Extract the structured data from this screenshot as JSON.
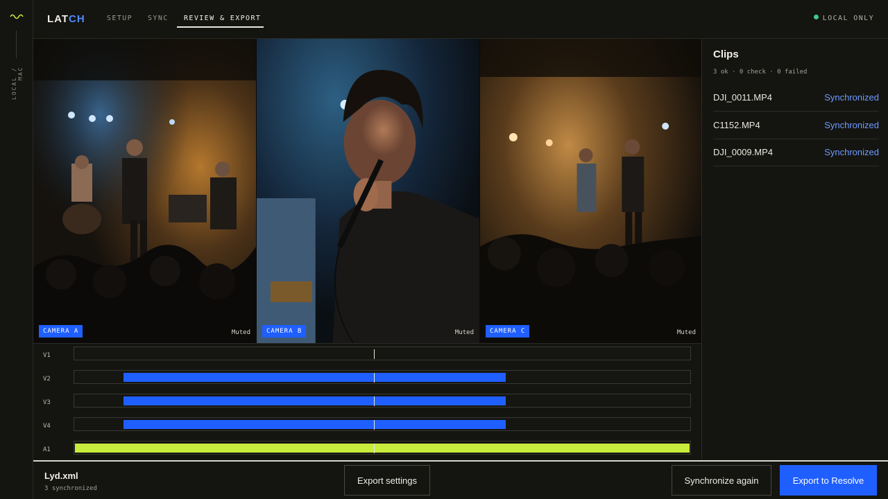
{
  "rail": {
    "logo_icon": "wave-icon",
    "context_label": "LOCAL / MAC"
  },
  "header": {
    "brand_prefix": "LAT",
    "brand_accent": "CH",
    "tabs": [
      {
        "label": "SETUP",
        "active": false
      },
      {
        "label": "SYNC",
        "active": false
      },
      {
        "label": "REVIEW & EXPORT",
        "active": true
      }
    ],
    "status_label": "LOCAL ONLY",
    "status_color": "#3ec98a"
  },
  "cameras": [
    {
      "label": "CAMERA A",
      "audio": "Muted"
    },
    {
      "label": "CAMERA B",
      "audio": "Muted"
    },
    {
      "label": "CAMERA C",
      "audio": "Muted"
    }
  ],
  "clips_panel": {
    "title": "Clips",
    "summary": "3 ok · 0 check · 0 failed",
    "clips": [
      {
        "name": "DJI_0011.MP4",
        "status": "Synchronized"
      },
      {
        "name": "C1152.MP4",
        "status": "Synchronized"
      },
      {
        "name": "DJI_0009.MP4",
        "status": "Synchronized"
      }
    ]
  },
  "timeline": {
    "tracks": [
      {
        "label": "V1",
        "kind": "video",
        "has_clip": false
      },
      {
        "label": "V2",
        "kind": "video",
        "has_clip": true
      },
      {
        "label": "V3",
        "kind": "video",
        "has_clip": true
      },
      {
        "label": "V4",
        "kind": "video",
        "has_clip": true
      },
      {
        "label": "A1",
        "kind": "audio",
        "has_clip": true
      }
    ],
    "video_clip_color": "#1f5fff",
    "audio_clip_color": "#c7ec3c"
  },
  "footer": {
    "file_name": "Lyd.xml",
    "file_status": "3 synchronized",
    "export_settings_label": "Export settings",
    "sync_again_label": "Synchronize again",
    "export_label": "Export to Resolve",
    "accent_color": "#1f5fff"
  }
}
